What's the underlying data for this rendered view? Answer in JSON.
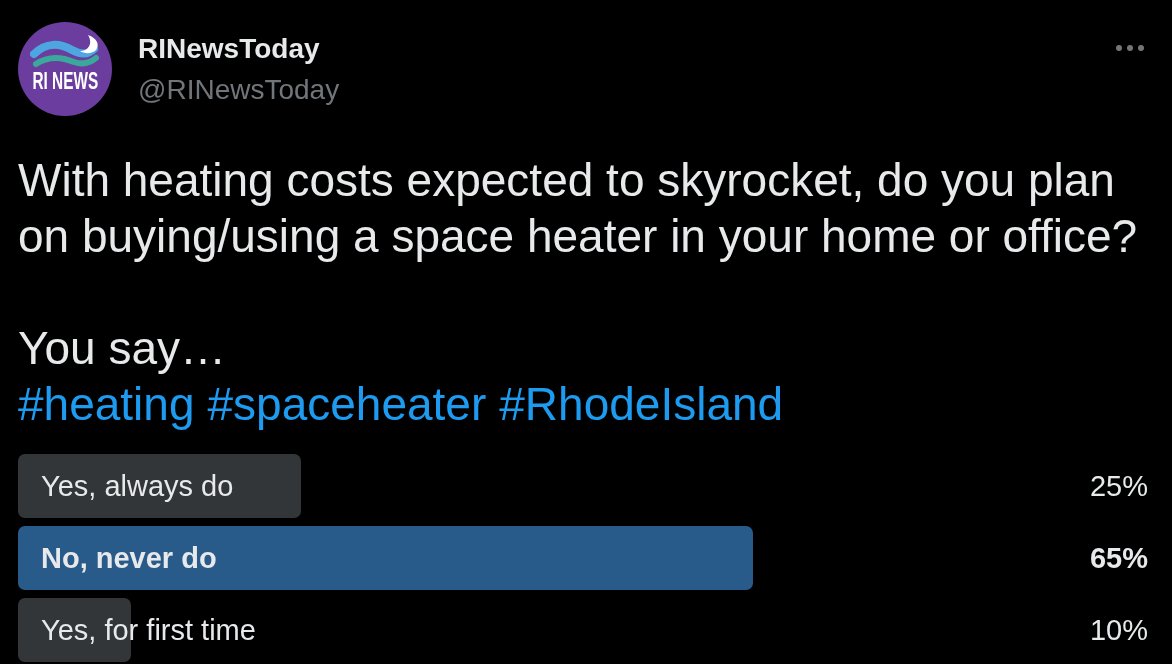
{
  "author": {
    "avatar_text": "RI NEWS",
    "name": "RINewsToday",
    "handle": "@RINewsToday"
  },
  "tweet": {
    "question": "With heating costs expected to skyrocket, do you plan on buying/using a space heater in your home or office?",
    "closing": "You say…",
    "hashtags": [
      "#heating",
      "#spaceheater",
      "#RhodeIsland"
    ]
  },
  "poll": {
    "options": [
      {
        "label": "Yes, always do",
        "percent": "25%",
        "level": 0.25,
        "winner": false
      },
      {
        "label": "No, never do",
        "percent": "65%",
        "level": 0.65,
        "winner": true
      },
      {
        "label": "Yes, for first time",
        "percent": "10%",
        "level": 0.1,
        "winner": false
      }
    ]
  }
}
